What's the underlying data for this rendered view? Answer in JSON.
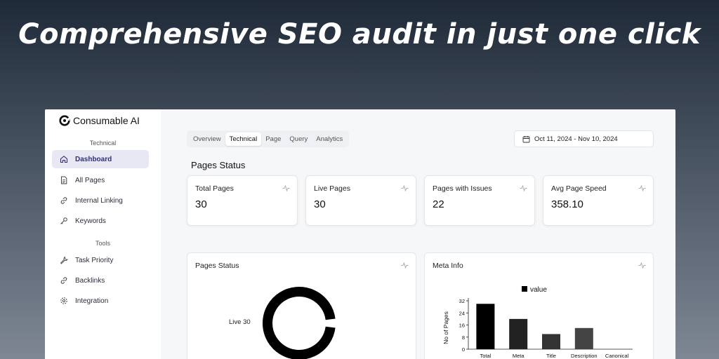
{
  "headline": "Comprehensive SEO audit in just one click",
  "brand": {
    "name": "Consumable AI",
    "icon": "consumable-logo-icon"
  },
  "sidebar": {
    "sections": [
      {
        "title": "Technical",
        "items": [
          {
            "label": "Dashboard",
            "icon": "home-icon",
            "active": true
          },
          {
            "label": "All Pages",
            "icon": "document-icon",
            "active": false
          },
          {
            "label": "Internal Linking",
            "icon": "link-icon",
            "active": false
          },
          {
            "label": "Keywords",
            "icon": "key-icon",
            "active": false
          }
        ]
      },
      {
        "title": "Tools",
        "items": [
          {
            "label": "Task Priority",
            "icon": "wrench-icon",
            "active": false
          },
          {
            "label": "Backlinks",
            "icon": "link-icon",
            "active": false
          },
          {
            "label": "Integration",
            "icon": "settings-icon",
            "active": false
          }
        ]
      }
    ]
  },
  "tabs": [
    {
      "label": "Overview",
      "active": false
    },
    {
      "label": "Technical",
      "active": true
    },
    {
      "label": "Page",
      "active": false
    },
    {
      "label": "Query",
      "active": false
    },
    {
      "label": "Analytics",
      "active": false
    }
  ],
  "date_range": {
    "label": "Oct 11, 2024 - Nov 10, 2024",
    "icon": "calendar-icon"
  },
  "section_heading": "Pages Status",
  "stats": [
    {
      "label": "Total Pages",
      "value": "30",
      "progress": 1.0,
      "icon": "activity-icon"
    },
    {
      "label": "Live Pages",
      "value": "30",
      "progress": 1.0,
      "icon": "activity-icon"
    },
    {
      "label": "Pages with Issues",
      "value": "22",
      "progress": 0.73,
      "icon": "activity-icon"
    },
    {
      "label": "Avg Page Speed",
      "value": "358.10",
      "progress": 1.0,
      "icon": "activity-icon"
    }
  ],
  "colors": {
    "bar_fill": "#2a2f45",
    "bar_fill_light": "#8a8f9a",
    "active_nav_bg": "#e8e8f5"
  },
  "panels": {
    "pages_status": {
      "title": "Pages Status",
      "donut_label": "Live 30"
    },
    "meta_info": {
      "title": "Meta Info"
    }
  },
  "chart_data": [
    {
      "type": "pie",
      "categories": [
        "Live"
      ],
      "values": [
        30
      ]
    },
    {
      "type": "bar",
      "categories": [
        "Total",
        "Meta",
        "Title",
        "Description",
        "Canonical"
      ],
      "series": [
        {
          "name": "value",
          "values": [
            30,
            20,
            10,
            14,
            0
          ],
          "colors": [
            "#000000",
            "#222222",
            "#333333",
            "#444444",
            "#555555"
          ]
        }
      ],
      "ylabel": "No of Pages",
      "yticks": [
        0,
        8,
        16,
        24,
        32
      ],
      "ylim": [
        0,
        32
      ]
    }
  ]
}
